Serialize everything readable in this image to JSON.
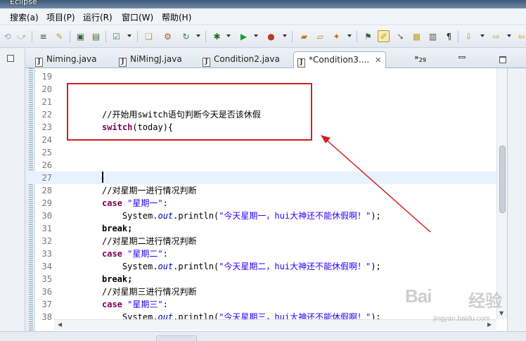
{
  "window": {
    "title": "Eclipse"
  },
  "menubar": [
    {
      "label": "搜索(a)"
    },
    {
      "label": "项目(P)"
    },
    {
      "label": "运行(R)"
    },
    {
      "label": "窗口(W)"
    },
    {
      "label": "帮助(H)"
    }
  ],
  "toolbar": {
    "icons": [
      "back-icon",
      "forward-icon",
      "toggle-comment-icon",
      "mark-occurrences-icon",
      "save-icon",
      "print-icon",
      "checkbox-icon",
      "new-java-file-icon",
      "build-icon",
      "refresh-icon",
      "debug-icon",
      "run-icon",
      "run-external-icon",
      "open-folder-icon",
      "open-resource-icon",
      "search-icon",
      "pin-icon",
      "highlight-icon",
      "next-annotation-icon",
      "open-type-icon",
      "show-whitespace-icon",
      "pilcrow-icon",
      "prev-edit-icon",
      "last-edit-icon",
      "prev-icon",
      "next-icon"
    ]
  },
  "editor_tabs": [
    {
      "label": "Niming.java",
      "active": false
    },
    {
      "label": "NiMingJ.java",
      "active": false
    },
    {
      "label": "Condition2.java",
      "active": false
    },
    {
      "label": "*Condition3....",
      "active": true
    }
  ],
  "tab_overflow": {
    "glyph": "»",
    "count": "29"
  },
  "editor": {
    "current_line": "27",
    "lines": [
      {
        "num": "19",
        "code": ""
      },
      {
        "num": "20",
        "code": ""
      },
      {
        "num": "21",
        "code": ""
      },
      {
        "num": "22",
        "code": "//开始用switch语句判断今天是否该休假"
      },
      {
        "num": "23",
        "code": "switch(today){"
      },
      {
        "num": "24",
        "code": ""
      },
      {
        "num": "25",
        "code": ""
      },
      {
        "num": "26",
        "code": ""
      },
      {
        "num": "27",
        "code": ""
      },
      {
        "num": "28",
        "code": "//对星期一进行情况判断"
      },
      {
        "num": "29",
        "code": "case \"星期一\":"
      },
      {
        "num": "30",
        "code": "    System.out.println(\"今天星期一，hui大神还不能休假啊！\");"
      },
      {
        "num": "31",
        "code": "break;"
      },
      {
        "num": "32",
        "code": "//对星期二进行情况判断"
      },
      {
        "num": "33",
        "code": "case \"星期二\":"
      },
      {
        "num": "34",
        "code": "    System.out.println(\"今天星期二，hui大神还不能休假啊！\");"
      },
      {
        "num": "35",
        "code": "break;"
      },
      {
        "num": "36",
        "code": "//对星期三进行情况判断"
      },
      {
        "num": "37",
        "code": "case \"星期三\":"
      },
      {
        "num": "38",
        "code": "    System.out.println(\"今天星期三，hui大神还不能休假啊！\");"
      }
    ]
  },
  "watermark": {
    "brand": "Bai",
    "brand_cn": "经验",
    "url": "jingyan.baidu.com"
  },
  "colors": {
    "keyword": "#7f0055",
    "comment": "#3f7f5f",
    "string": "#2a00ff",
    "field": "#0000c0",
    "annotation": "#d21f1f",
    "current_line": "#e8f2fe"
  }
}
